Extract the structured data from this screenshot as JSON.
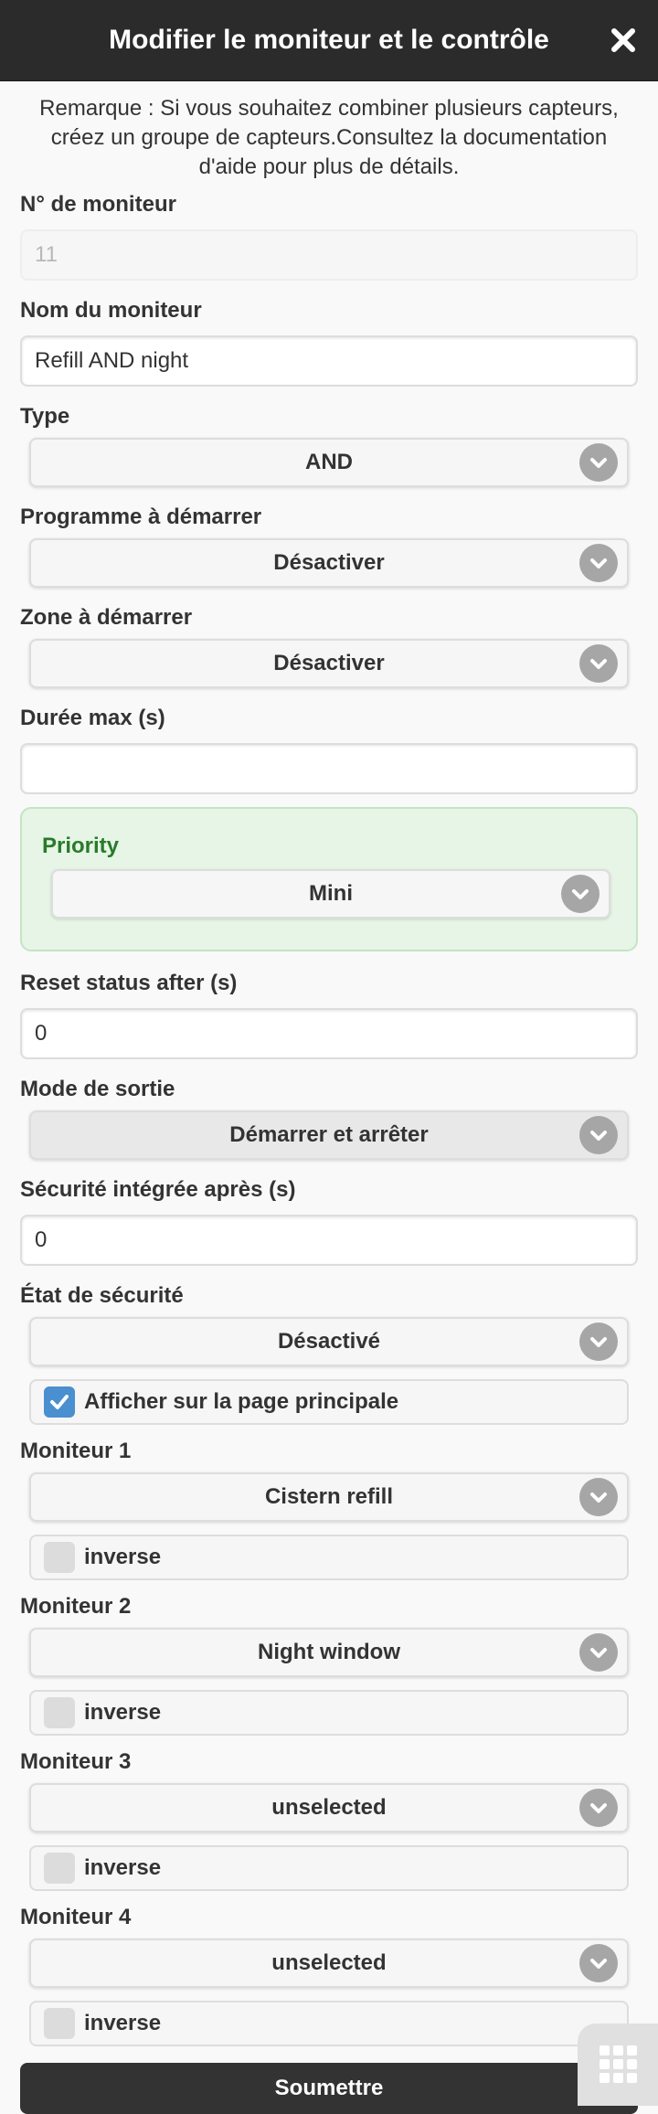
{
  "header": {
    "title": "Modifier le moniteur et le contrôle"
  },
  "note": "Remarque : Si vous souhaitez combiner plusieurs capteurs, créez un groupe de capteurs.Consultez la documentation d'aide pour plus de détails.",
  "fields": {
    "monitor_number": {
      "label": "N° de moniteur",
      "value": "11"
    },
    "monitor_name": {
      "label": "Nom du moniteur",
      "value": "Refill AND night"
    },
    "type": {
      "label": "Type",
      "value": "AND"
    },
    "program": {
      "label": "Programme à démarrer",
      "value": "Désactiver"
    },
    "zone": {
      "label": "Zone à démarrer",
      "value": "Désactiver"
    },
    "max_duration": {
      "label": "Durée max (s)",
      "value": ""
    },
    "priority": {
      "label": "Priority",
      "value": "Mini"
    },
    "reset_status": {
      "label": "Reset status after (s)",
      "value": "0"
    },
    "output_mode": {
      "label": "Mode de sortie",
      "value": "Démarrer et arrêter"
    },
    "failsafe_after": {
      "label": "Sécurité intégrée après (s)",
      "value": "0"
    },
    "safety_state": {
      "label": "État de sécurité",
      "value": "Désactivé"
    },
    "show_main": {
      "label": "Afficher sur la page principale",
      "checked": true
    }
  },
  "monitors": [
    {
      "label": "Moniteur 1",
      "value": "Cistern refill",
      "inverse_label": "inverse",
      "inverse": false
    },
    {
      "label": "Moniteur 2",
      "value": "Night window",
      "inverse_label": "inverse",
      "inverse": false
    },
    {
      "label": "Moniteur 3",
      "value": "unselected",
      "inverse_label": "inverse",
      "inverse": false
    },
    {
      "label": "Moniteur 4",
      "value": "unselected",
      "inverse_label": "inverse",
      "inverse": false
    }
  ],
  "submit_label": "Soumettre",
  "icons": {
    "close": "close-icon",
    "chevron": "chevron-down-icon",
    "grid": "grid-menu-icon",
    "check": "check-icon"
  },
  "colors": {
    "header_bg": "#2b2b2b",
    "priority_bg": "#e6f5e6",
    "priority_label": "#2a7a2a",
    "checkbox_on": "#4a8fcf"
  }
}
